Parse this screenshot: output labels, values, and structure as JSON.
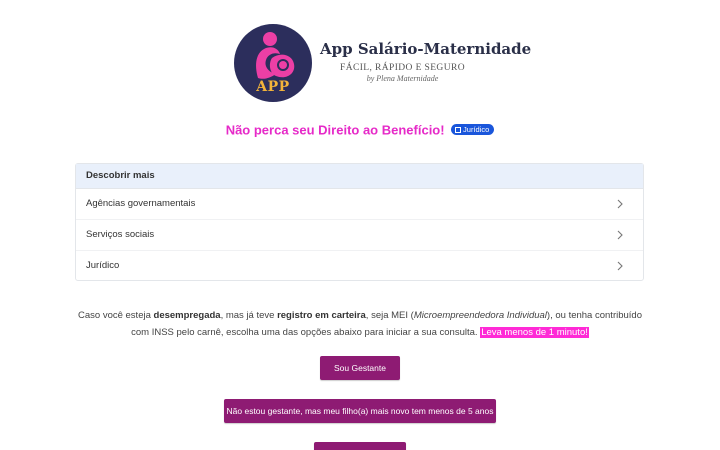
{
  "header": {
    "logo_text": "APP",
    "title": "App Salário-Maternidade",
    "subtitle": "FÁCIL, RÁPIDO E SEGURO",
    "byline": "by Plena Maternidade"
  },
  "headline": {
    "text": "Não perca seu Direito ao Benefício!",
    "badge": "Jurídico"
  },
  "discover": {
    "title": "Descobrir mais",
    "items": [
      {
        "label": "Agências governamentais"
      },
      {
        "label": "Serviços sociais"
      },
      {
        "label": "Jurídico"
      }
    ]
  },
  "description": {
    "p1": "Caso você esteja ",
    "b1": "desempregada",
    "p2": ", mas já teve ",
    "b2": "registro em carteira",
    "p3": ", seja MEI (",
    "i1": "Microempreendedora Individual",
    "p4": "), ou tenha contribuído com INSS pelo carnê, escolha uma das opções abaixo para iniciar a sua consulta. ",
    "highlight": "Leva menos de 1 minuto!"
  },
  "buttons": {
    "gestante": "Sou Gestante",
    "filho": "Não estou gestante, mas meu filho(a) mais novo tem menos de 5 anos"
  },
  "colors": {
    "accent": "#e62ac8",
    "button": "#8e1b73",
    "logo_bg": "#2c2e5c",
    "badge": "#1a56db"
  }
}
